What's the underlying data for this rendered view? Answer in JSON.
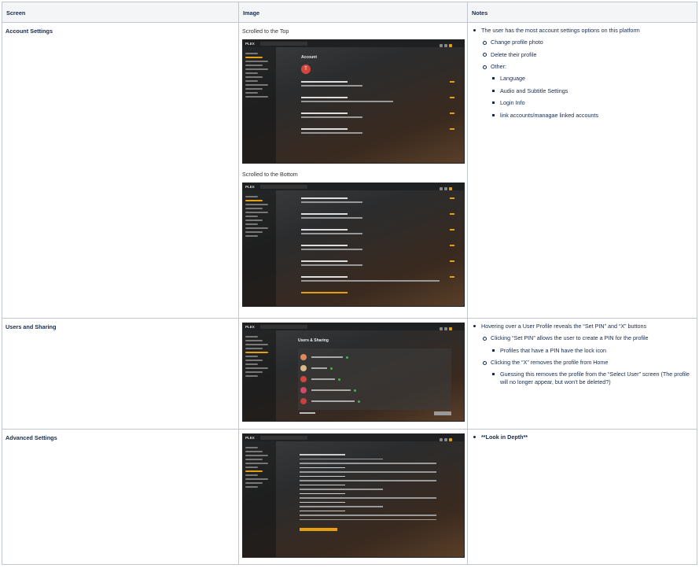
{
  "table": {
    "headers": [
      "Screen",
      "Image",
      "Notes"
    ],
    "rows": [
      {
        "screen": "Account Settings",
        "captions": [
          "Scrolled to the Top",
          "Scrolled to the Bottom"
        ],
        "mock": {
          "logo": "PLEX",
          "title": "Account",
          "avatar_letter": "T"
        },
        "notes": {
          "main": "The user has the most account settings options on this platform",
          "sub": [
            "Change profile photo",
            "Delete their profile",
            "Other:"
          ],
          "other": [
            "Language",
            "Audio and Subtitle Settings",
            "Login Info",
            "link accounts/managae linked accounts"
          ]
        }
      },
      {
        "screen": "Users and Sharing",
        "mock": {
          "logo": "PLEX",
          "title": "Users & Sharing"
        },
        "notes": {
          "main": "Hovering over a User Profile reveals the “Set PIN” and “X” buttons",
          "a": "Clicking “Set PIN” allows the user to create a PIN for the profile",
          "a_sub": "Profiles that have a PIN have the lock icon",
          "b": "Clicking the “X” removes the profile from Home",
          "b_sub": "Guessing this removes the profile from the “Select User” screen (The profile will no longer appear, but won’t be deleted?)"
        }
      },
      {
        "screen": "Advanced Settings",
        "mock": {
          "logo": "PLEX"
        },
        "notes": {
          "main": "**Look in Depth**"
        }
      }
    ]
  },
  "colors": {
    "accent": "#e5a00d",
    "border": "#c1c7d0",
    "header_bg": "#f4f5f7",
    "avatar": "#d4453c"
  }
}
